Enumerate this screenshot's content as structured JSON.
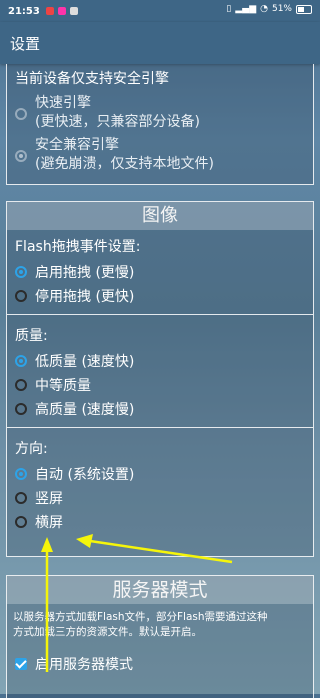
{
  "status": {
    "time": "21:53",
    "battery": "51%"
  },
  "appbar": {
    "title": "设置"
  },
  "engine": {
    "heading": "当前设备仅支持安全引擎",
    "options": [
      {
        "line1": "快速引擎",
        "line2": "(更快速，只兼容部分设备)",
        "checked": false
      },
      {
        "line1": "安全兼容引擎",
        "line2": "(避免崩溃，仅支持本地文件)",
        "checked": true
      }
    ]
  },
  "image": {
    "title": "图像",
    "drag_label": "Flash拖拽事件设置:",
    "drag_options": [
      "启用拖拽 (更慢)",
      "停用拖拽 (更快)"
    ],
    "quality_label": "质量:",
    "quality_options": [
      "低质量 (速度快)",
      "中等质量",
      "高质量 (速度慢)"
    ],
    "orientation_label": "方向:",
    "orientation_options": [
      "自动 (系统设置)",
      "竖屏",
      "横屏"
    ]
  },
  "server": {
    "title": "服务器模式",
    "desc1": "以服务器方式加载Flash文件，部分Flash需要通过这种",
    "desc2": "方式加载三方的资源文件。默认是开启。",
    "checkbox_label": "启用服务器模式"
  },
  "annotation": {
    "arrow_color": "#f5f50a"
  }
}
